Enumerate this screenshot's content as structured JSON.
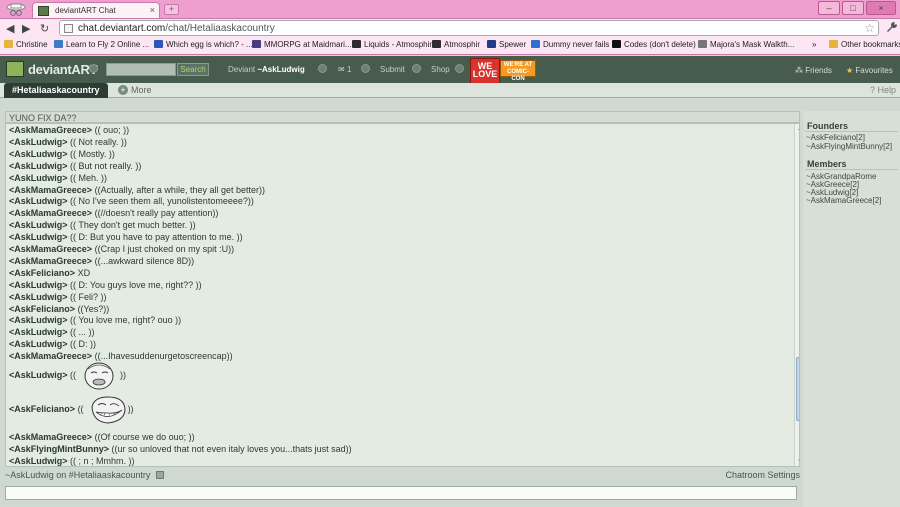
{
  "browser": {
    "tab_title": "deviantART Chat",
    "tab_close": "×",
    "new_tab": "+",
    "window_buttons": [
      "–",
      "□",
      "×"
    ],
    "back": "◀",
    "forward": "▶",
    "reload": "↻",
    "url_host": "chat.deviantart.com",
    "url_path": "/chat/Hetaliaaskacountry",
    "star": "☆",
    "wrench": "🔧",
    "bookmarks": [
      {
        "label": "Christine",
        "color": "#e8b33a"
      },
      {
        "label": "Learn to Fly 2 Online ...",
        "color": "#3b7cc8"
      },
      {
        "label": "Which egg is which? - ...",
        "color": "#2a57b8"
      },
      {
        "label": "MMORPG at Maidmari...",
        "color": "#4a3a80"
      },
      {
        "label": "Liquids - Atmosphir",
        "color": "#2c2c2c"
      },
      {
        "label": "Atmosphir",
        "color": "#2c2c2c"
      },
      {
        "label": "Spewer",
        "color": "#1d3f8a"
      },
      {
        "label": "Dummy never fails",
        "color": "#2f6fd0"
      },
      {
        "label": "Codes (don't delete)",
        "color": "#111111"
      },
      {
        "label": "Majora's Mask Walkth...",
        "color": "#777777"
      }
    ],
    "other_bookmarks": "Other bookmarks",
    "overflow": "»"
  },
  "da": {
    "wordmark": "deviantART",
    "search_button": "Search",
    "deviant_prefix": "Deviant",
    "username": "~AskLudwig",
    "messages_count": "1",
    "submit": "Submit",
    "shop": "Shop",
    "badge_text": "WE LOVE",
    "badge2_text": "WE'RE AT COMIC-CON",
    "friends": "Friends",
    "favourites": "Favourites",
    "help": "Help"
  },
  "room": {
    "tab": "#Hetaliaaskacountry",
    "more": "More",
    "topic": "YUNO FIX DA??"
  },
  "chat": [
    {
      "nick": "<AskMamaGreece>",
      "text": "(( ouo; ))"
    },
    {
      "nick": "<AskLudwig>",
      "text": "(( Not really. ))"
    },
    {
      "nick": "<AskLudwig>",
      "text": "(( Mostly. ))"
    },
    {
      "nick": "<AskLudwig>",
      "text": "(( But not really. ))"
    },
    {
      "nick": "<AskLudwig>",
      "text": "(( Meh. ))"
    },
    {
      "nick": "<AskMamaGreece>",
      "text": "((Actually, after a while, they all get better))"
    },
    {
      "nick": "<AskLudwig>",
      "text": "(( No I've seen them all, yunolistentomeeee?))"
    },
    {
      "nick": "<AskMamaGreece>",
      "text": "((//doesn't really pay attention))"
    },
    {
      "nick": "<AskLudwig>",
      "text": "(( They don't get much better. ))"
    },
    {
      "nick": "<AskLudwig>",
      "text": "(( D: But you have to pay attention to me. ))"
    },
    {
      "nick": "<AskMamaGreece>",
      "text": "((Crap I just choked on my spit :U))"
    },
    {
      "nick": "<AskMamaGreece>",
      "text": "((...awkward silence 8D))"
    },
    {
      "nick": "<AskFeliciano>",
      "text": "XD"
    },
    {
      "nick": "<AskLudwig>",
      "text": "(( D: You guys love me, right?? ))"
    },
    {
      "nick": "<AskLudwig>",
      "text": "(( Feli? ))"
    },
    {
      "nick": "<AskFeliciano>",
      "text": "((Yes?))"
    },
    {
      "nick": "<AskLudwig>",
      "text": "(( You love me, right? ouo ))"
    },
    {
      "nick": "<AskLudwig>",
      "text": "(( ... ))"
    },
    {
      "nick": "<AskLudwig>",
      "text": "(( D: ))"
    },
    {
      "nick": "<AskMamaGreece>",
      "text": "((...Ihavesuddenurgetoscreencap))"
    }
  ],
  "emote_lines": [
    {
      "nick": "<AskLudwig>",
      "pre": "((",
      "post": "))",
      "emote": "forever-alone-face"
    },
    {
      "nick": "<AskFeliciano>",
      "pre": "((",
      "post": "))",
      "emote": "troll-face"
    }
  ],
  "chat_tail": [
    {
      "nick": "<AskMamaGreece>",
      "text": "((Of course we do ouo; ))"
    },
    {
      "nick": "<AskFlyingMintBunny>",
      "text": "((ur so unloved that not even italy loves you...thats just sad))"
    },
    {
      "nick": "<AskLudwig>",
      "text": "(( ; n ; Mmhm. ))"
    }
  ],
  "status": {
    "user_room": "~AskLudwig on #Hetaliaaskacountry",
    "settings": "Chatroom Settings"
  },
  "sidebar": {
    "founders_title": "Founders",
    "founders": [
      "~AskFeliciano[2]",
      "~AskFlyingMintBunny[2]"
    ],
    "members_title": "Members",
    "members": [
      "~AskGrandpaRome",
      "~AskGreece[2]",
      "~AskLudwig[2]",
      "~AskMamaGreece[2]"
    ]
  },
  "colors": {
    "chrome_pink": "#ee9fd0",
    "da_header": "#475c4d",
    "chat_bg": "#e3ebe3"
  }
}
